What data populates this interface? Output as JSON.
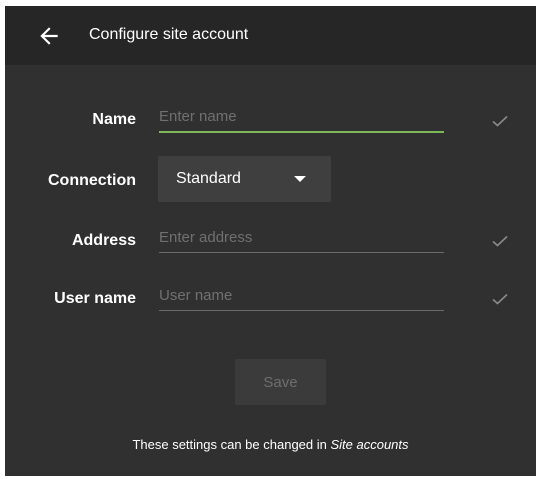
{
  "appbar": {
    "title": "Configure site account",
    "back_icon": "arrow-left-icon"
  },
  "form": {
    "name": {
      "label": "Name",
      "value": "",
      "placeholder": "Enter name",
      "focused": true,
      "status_icon": "check-icon"
    },
    "connection": {
      "label": "Connection",
      "selected": "Standard",
      "icon": "caret-down-icon"
    },
    "address": {
      "label": "Address",
      "value": "",
      "placeholder": "Enter address",
      "status_icon": "check-icon"
    },
    "username": {
      "label": "User name",
      "value": "",
      "placeholder": "User name",
      "status_icon": "check-icon"
    }
  },
  "save": {
    "label": "Save",
    "disabled": true
  },
  "footer": {
    "text": "These settings can be changed in ",
    "link": "Site accounts"
  },
  "colors": {
    "background": "#303030",
    "appbar": "#262626",
    "accent_focus": "#7cb85a",
    "check": "#8a8a8a"
  }
}
